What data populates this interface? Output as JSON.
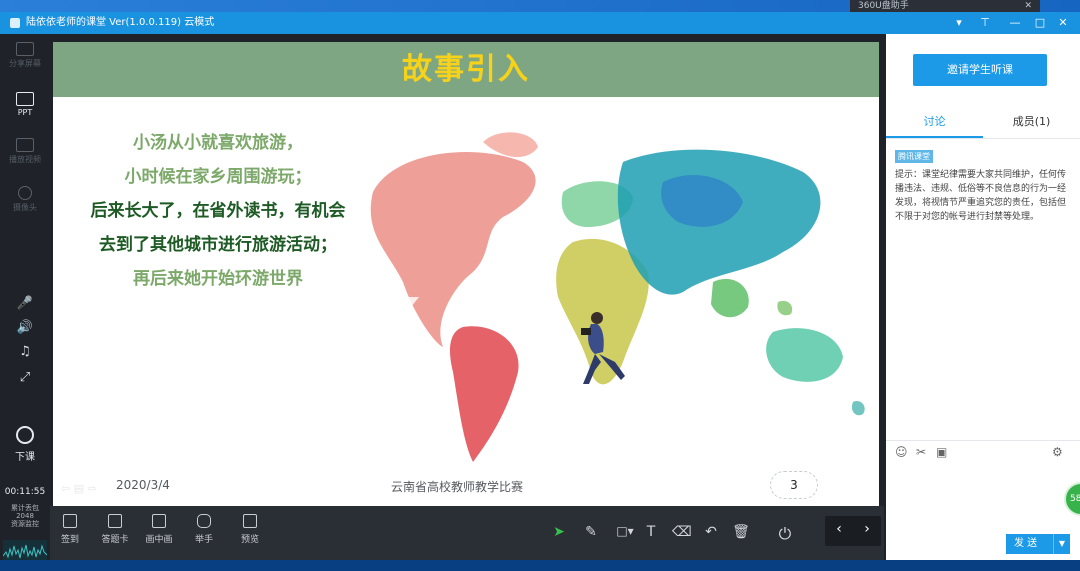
{
  "window": {
    "title": "陆依依老师的课堂 Ver(1.0.0.119)  云模式",
    "controls": [
      "▾",
      "⊤",
      "—",
      "□",
      "✕"
    ]
  },
  "external_tab": {
    "label": "360U盘助手",
    "close": "✕"
  },
  "left_toolbar": {
    "items": [
      {
        "label": "分享屏幕",
        "icon": "share-screen-icon"
      },
      {
        "label": "PPT",
        "icon": "ppt-icon"
      },
      {
        "label": "播放视频",
        "icon": "play-video-icon"
      },
      {
        "label": "摄像头",
        "icon": "camera-icon"
      }
    ],
    "glyphs": [
      "🎤",
      "🔊",
      "♫",
      "⤢"
    ],
    "end_class": "下课",
    "timer": "00:11:55",
    "stats": [
      "累计丢包",
      "2048",
      "资源监控"
    ]
  },
  "slide": {
    "title": "故事引入",
    "lines": [
      "小汤从小就喜欢旅游，",
      "小时候在家乡周围游玩；",
      "后来长大了，在省外读书，有机会",
      "去到了其他城市进行旅游活动；",
      "再后来她开始环游世界"
    ],
    "date": "2020/3/4",
    "organizer": "云南省高校教师教学比赛",
    "page_number": "3",
    "nav": "⇦  ▤  ⇨"
  },
  "bottom_toolbar": {
    "buttons": [
      "签到",
      "答题卡",
      "画中画",
      "举手",
      "预览"
    ],
    "tools": [
      "➤",
      "✎",
      "□▾",
      "T",
      "⌫",
      "↶",
      "🗑"
    ],
    "power": "⏻",
    "prev": "‹",
    "next": "›"
  },
  "right_panel": {
    "invite_button": "邀请学生听课",
    "tabs": [
      "讨论",
      "成员(1)"
    ],
    "badge": "腾讯课堂",
    "notice": "提示：课堂纪律需要大家共同维护，任何传播违法、违规、低俗等不良信息的行为一经发现，将视情节严重追究您的责任，包括但不限于对您的帐号进行封禁等处理。",
    "chat_tools": [
      "☺",
      "✂",
      "▣",
      "⚙"
    ],
    "send_label": "发 送",
    "send_dropdown": "▼"
  },
  "float_badge": "58",
  "colors": {
    "title_bar": "#1993e0",
    "slide_header": "#7fa682",
    "slide_title": "#f6d21b",
    "accent": "#1c9ae8"
  }
}
